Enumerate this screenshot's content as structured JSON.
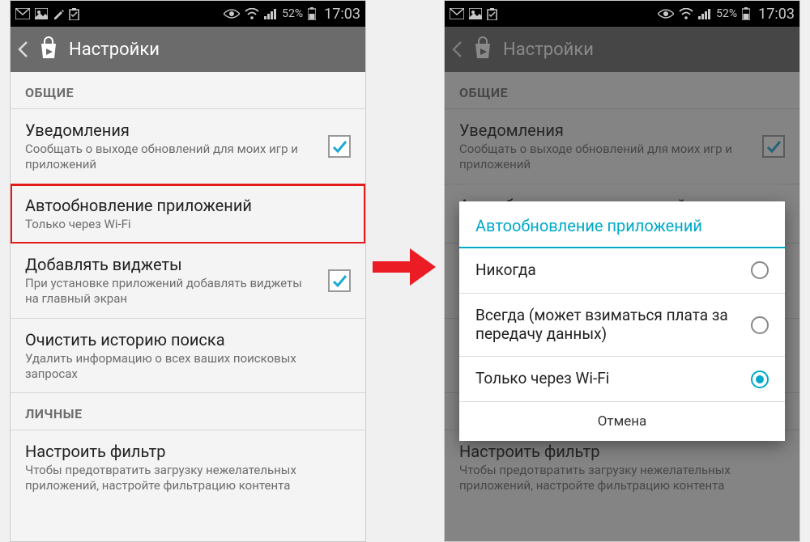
{
  "status": {
    "battery_pct": "52%",
    "time": "17:03"
  },
  "actionbar": {
    "title": "Настройки"
  },
  "sections": {
    "general": "ОБЩИЕ",
    "personal": "ЛИЧНЫЕ"
  },
  "rows": {
    "notifications": {
      "title": "Уведомления",
      "sub": "Сообщать о выходе обновлений для моих игр и приложений",
      "checked": true
    },
    "autoupdate": {
      "title": "Автообновление приложений",
      "sub": "Только через Wi-Fi"
    },
    "widgets": {
      "title": "Добавлять виджеты",
      "sub": "При установке приложений добавлять виджеты на главный экран",
      "checked": true
    },
    "clear_history": {
      "title": "Очистить историю поиска",
      "sub": "Удалить информацию о всех ваших поисковых запросах"
    },
    "filter": {
      "title": "Настроить фильтр",
      "sub": "Чтобы предотвратить загрузку нежелательных приложений, настройте фильтрацию контента"
    }
  },
  "dialog": {
    "title": "Автообновление приложений",
    "options": {
      "never": "Никогда",
      "always": "Всегда (может взиматься плата за передачу данных)",
      "wifi": "Только через Wi-Fi"
    },
    "cancel": "Отмена",
    "selected": "wifi"
  },
  "colors": {
    "highlight": "#e41b1b",
    "accent": "#00a9c9"
  }
}
